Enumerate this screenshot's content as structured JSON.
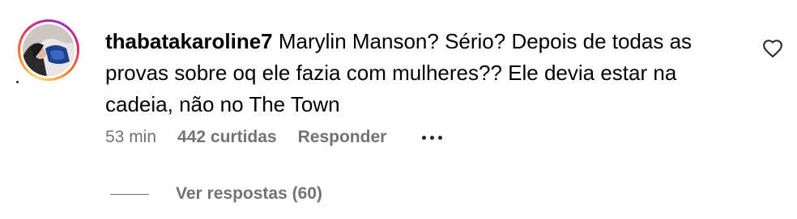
{
  "comment": {
    "username": "thabatakaroline7",
    "text": "Marylin Manson? Sério? Depois de todas as provas sobre oq ele fazia com mulheres?? Ele devia estar na cadeia, não no The Town",
    "time": "53 min",
    "likes": "442 curtidas",
    "reply_label": "Responder",
    "more_icon": "ellipsis-icon",
    "like_icon": "heart-outline-icon",
    "view_replies": "Ver respostas (60)"
  },
  "colors": {
    "text": "#000000",
    "muted": "#737373",
    "story_ring": [
      "#feda75",
      "#fa7e1e",
      "#d62976",
      "#962fbf"
    ]
  }
}
